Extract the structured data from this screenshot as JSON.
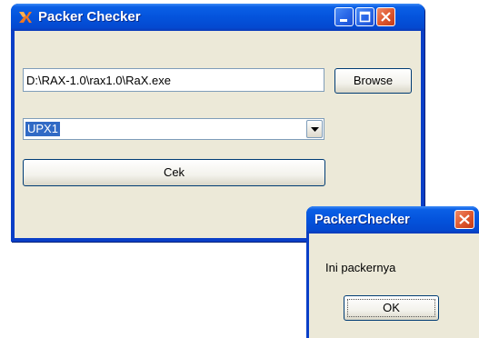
{
  "main_window": {
    "title": "Packer Checker",
    "path_field_value": "D:\\RAX-1.0\\rax1.0\\RaX.exe",
    "browse_label": "Browse",
    "packer_select_value": "UPX1",
    "check_label": "Cek"
  },
  "dialog": {
    "title": "PackerChecker",
    "message": "Ini packernya",
    "ok_label": "OK"
  },
  "colors": {
    "titlebar_blue": "#0453dc",
    "client_bg": "#ece9d8",
    "close_red": "#e05a30",
    "selection_blue": "#316ac5",
    "app_icon_orange": "#f07820"
  },
  "icons": {
    "app": "orange-x-icon",
    "minimize": "minimize-icon",
    "maximize": "maximize-icon",
    "close": "close-icon",
    "dropdown": "chevron-down-icon"
  }
}
